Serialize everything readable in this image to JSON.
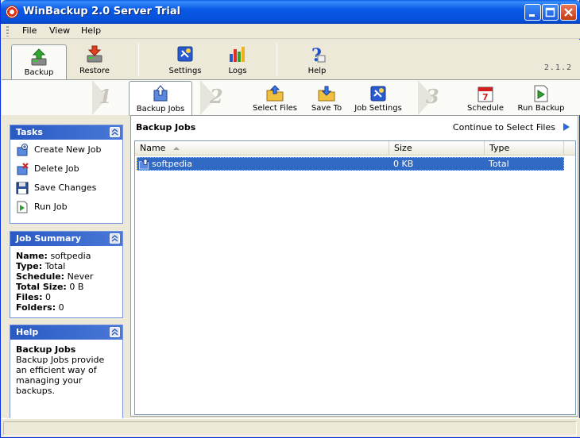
{
  "window": {
    "title": "WinBackup 2.0 Server Trial"
  },
  "menu": {
    "file": "File",
    "view": "View",
    "help": "Help"
  },
  "toolbar": {
    "backup": "Backup",
    "restore": "Restore",
    "settings": "Settings",
    "logs": "Logs",
    "help": "Help",
    "version": "2.1.2"
  },
  "wizard": {
    "step1": "1",
    "step2": "2",
    "step3": "3",
    "backup_jobs": "Backup Jobs",
    "select_files": "Select Files",
    "save_to": "Save To",
    "job_settings": "Job Settings",
    "schedule": "Schedule",
    "run_backup": "Run Backup"
  },
  "tasks": {
    "title": "Tasks",
    "items": [
      {
        "label": "Create New Job",
        "icon": "new-job-icon"
      },
      {
        "label": "Delete Job",
        "icon": "delete-job-icon"
      },
      {
        "label": "Save Changes",
        "icon": "save-icon"
      },
      {
        "label": "Run Job",
        "icon": "run-icon"
      }
    ]
  },
  "summary": {
    "title": "Job Summary",
    "name_label": "Name:",
    "name_value": "softpedia",
    "type_label": "Type:",
    "type_value": "Total",
    "schedule_label": "Schedule:",
    "schedule_value": "Never",
    "size_label": "Total Size:",
    "size_value": "0 B",
    "files_label": "Files:",
    "files_value": "0",
    "folders_label": "Folders:",
    "folders_value": "0"
  },
  "help": {
    "title": "Help",
    "heading": "Backup Jobs",
    "body": "Backup Jobs provide an efficient way of managing your backups."
  },
  "content": {
    "title": "Backup Jobs",
    "continue": "Continue to Select Files",
    "columns": {
      "name": "Name",
      "size": "Size",
      "type": "Type"
    },
    "rows": [
      {
        "name": "softpedia",
        "size": "0 KB",
        "type": "Total"
      }
    ]
  },
  "colors": {
    "titlebar": "#0859e6",
    "selection": "#316ac5",
    "panel_header": "#2959c3"
  }
}
